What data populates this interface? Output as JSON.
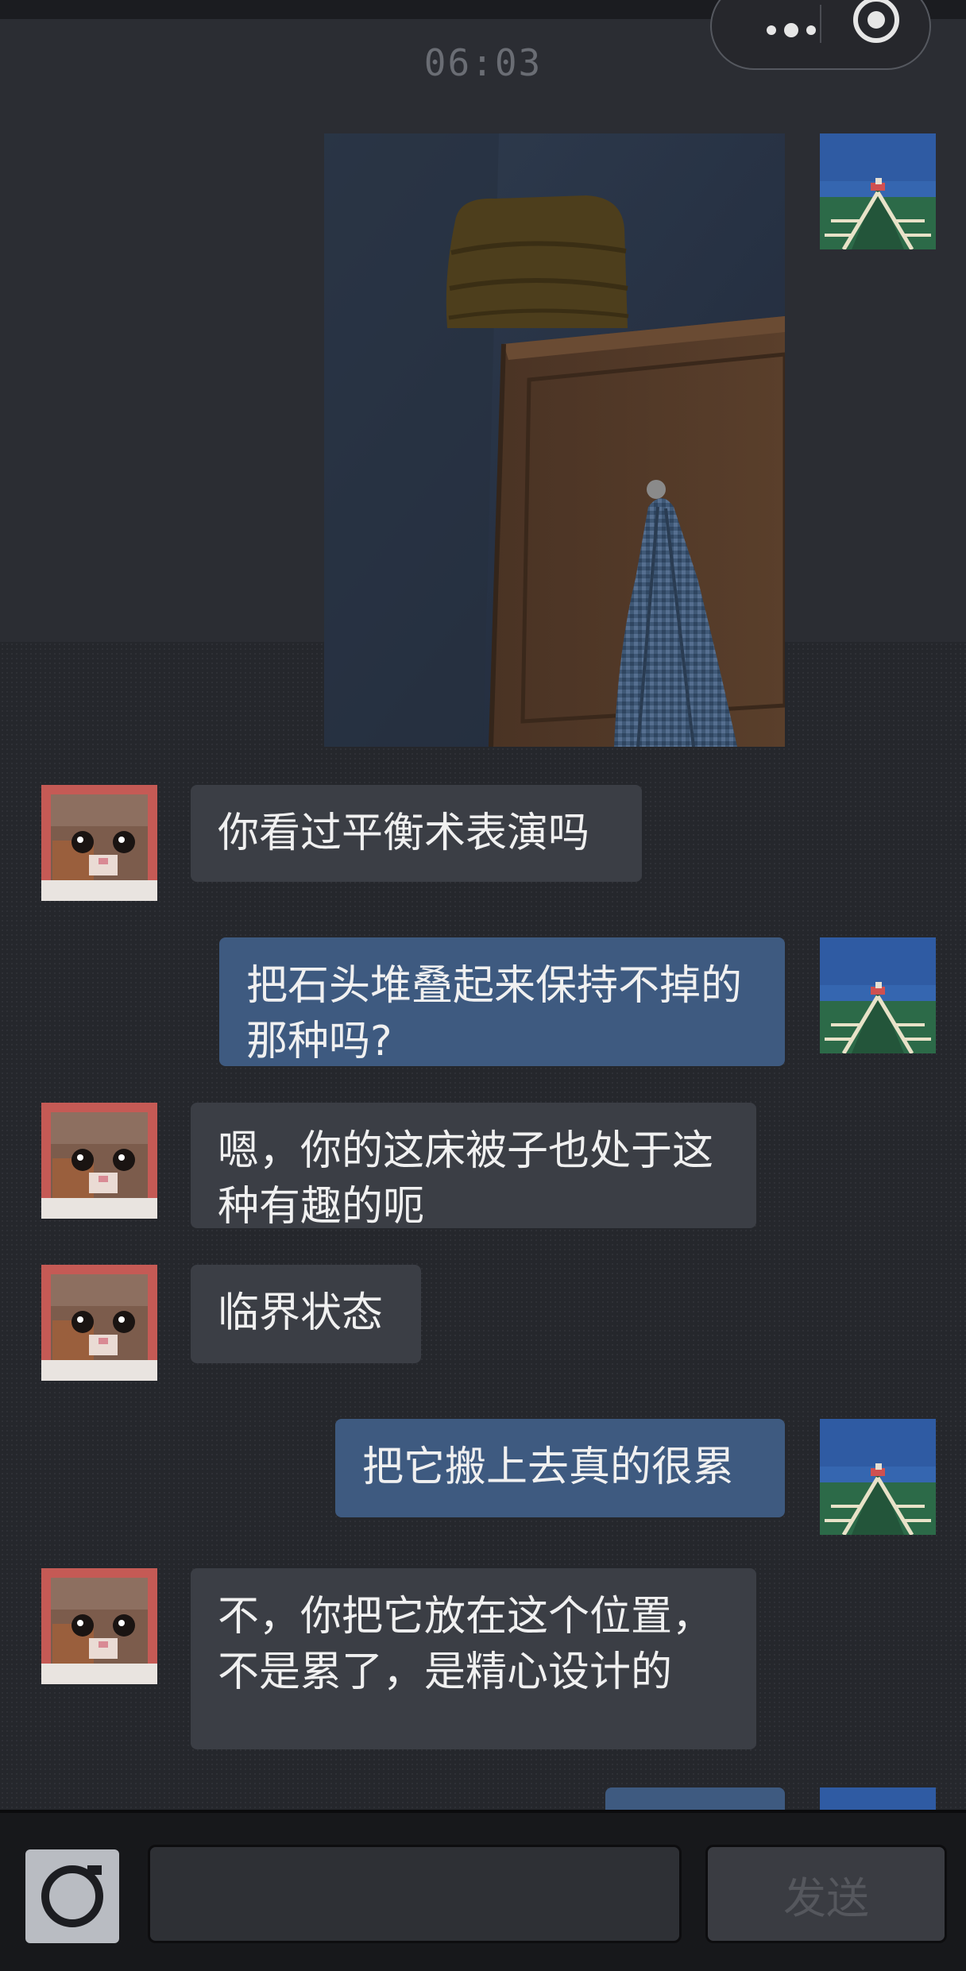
{
  "status": {
    "time": "06:03"
  },
  "capsule": {
    "menu_icon": "more-dots-icon",
    "close_icon": "target-circle-icon"
  },
  "messages": [
    {
      "side": "out",
      "type": "image",
      "sender": "user",
      "image_alt": "wooden wardrobe with folded yellow quilt on top and a blue checked shirt on a hook"
    },
    {
      "side": "in",
      "type": "text",
      "text": "你看过平衡术表演吗"
    },
    {
      "side": "out",
      "type": "text",
      "text": "把石头堆叠起来保持不掉的那种吗?"
    },
    {
      "side": "in",
      "type": "text",
      "text": "嗯，你的这床被子也处于这种有趣的呃"
    },
    {
      "side": "in",
      "type": "text",
      "text": "临界状态"
    },
    {
      "side": "out",
      "type": "text",
      "text": "把它搬上去真的很累"
    },
    {
      "side": "in",
      "type": "text",
      "text": "不，你把它放在这个位置，不是累了，是精心设计的"
    }
  ],
  "input": {
    "camera_icon": "camera-icon",
    "value": "",
    "send_label": "发送"
  },
  "colors": {
    "background": "#2b2d33",
    "incoming_bubble": "#3b3e45",
    "outgoing_bubble": "#3e5a80",
    "input_bar": "#17181b"
  }
}
